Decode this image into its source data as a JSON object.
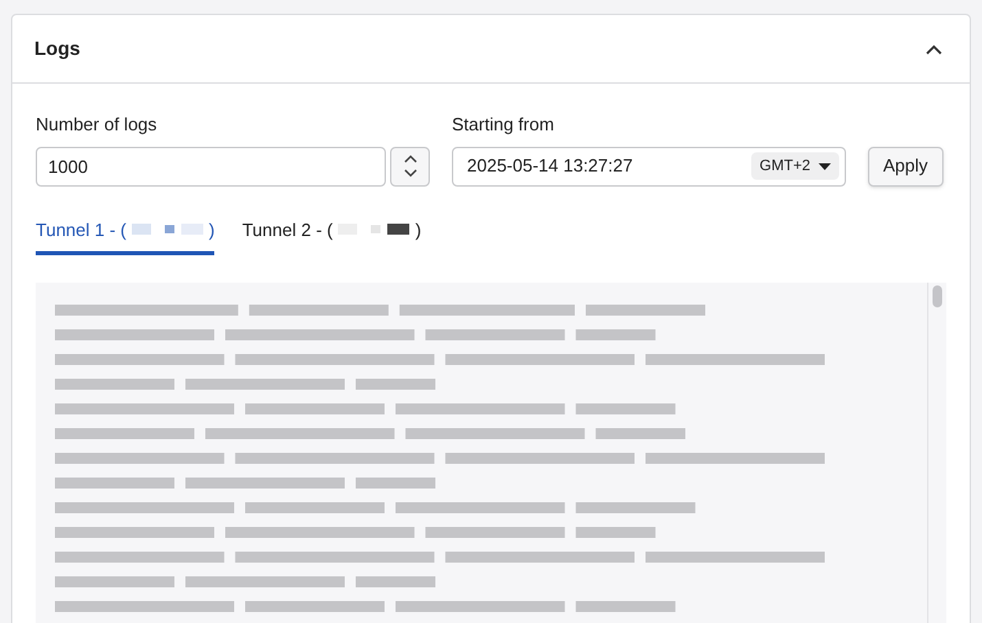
{
  "panel": {
    "title": "Logs",
    "expanded": true
  },
  "count_field": {
    "label": "Number of logs",
    "value": "1000"
  },
  "start_field": {
    "label": "Starting from",
    "value": "2025-05-14 13:27:27",
    "timezone": "GMT+2"
  },
  "apply_button": "Apply",
  "tabs": [
    {
      "prefix": "Tunnel 1 - (",
      "suffix": ")",
      "selected": true
    },
    {
      "prefix": "Tunnel 2 - (",
      "suffix": ")",
      "selected": false
    }
  ]
}
